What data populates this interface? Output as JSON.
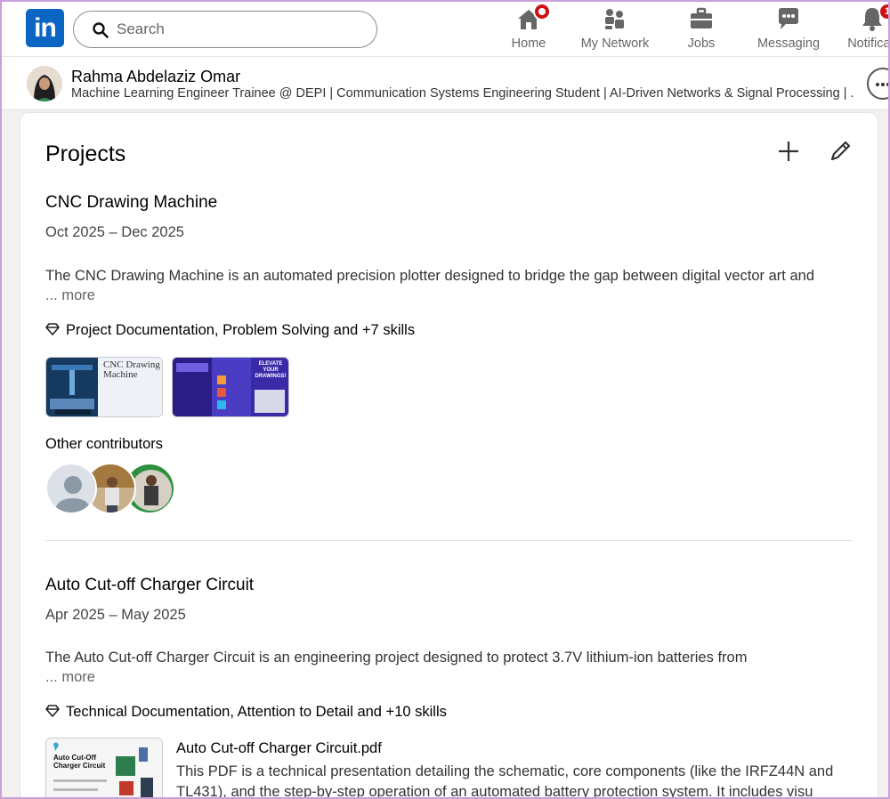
{
  "nav": {
    "search_placeholder": "Search",
    "items": [
      {
        "label": "Home",
        "icon": "home-icon"
      },
      {
        "label": "My Network",
        "icon": "network-icon"
      },
      {
        "label": "Jobs",
        "icon": "briefcase-icon"
      },
      {
        "label": "Messaging",
        "icon": "messaging-icon"
      },
      {
        "label": "Notificati",
        "icon": "bell-icon",
        "badge": "1"
      }
    ]
  },
  "profile": {
    "name": "Rahma Abdelaziz Omar",
    "headline": "Machine Learning Engineer Trainee @ DEPI | Communication Systems Engineering Student | AI-Driven Networks & Signal Processing | ..."
  },
  "section": {
    "title": "Projects"
  },
  "projects": [
    {
      "title": "CNC Drawing Machine",
      "dates": "Oct 2025 – Dec 2025",
      "description": "The CNC Drawing Machine is an automated precision plotter designed to bridge the gap between digital vector art and",
      "more": "more",
      "ellipsis": "...",
      "skills": "Project Documentation, Problem Solving and +7 skills",
      "media": [
        {
          "caption": "CNC Drawing Machine"
        },
        {
          "caption": "ELEVATE YOUR DRAWINGS!"
        }
      ],
      "contributors_label": "Other contributors"
    },
    {
      "title": "Auto Cut-off Charger Circuit",
      "dates": "Apr 2025 – May 2025",
      "description": "The Auto Cut-off Charger Circuit is an engineering project designed to protect 3.7V lithium-ion batteries from",
      "more": "more",
      "ellipsis": "...",
      "skills": "Technical Documentation, Attention to Detail and +10 skills",
      "document": {
        "thumb_caption": "Auto Cut-Off Charger Circuit",
        "title": "Auto Cut-off Charger Circuit.pdf",
        "description": "This PDF is a technical presentation detailing the schematic, core components (like the IRFZ44N and TL431), and the step-by-step operation of an automated battery protection system. It includes visu"
      }
    }
  ],
  "colors": {
    "brand": "#0a66c2",
    "badge": "#cc1016",
    "background": "#f4f2ee"
  }
}
